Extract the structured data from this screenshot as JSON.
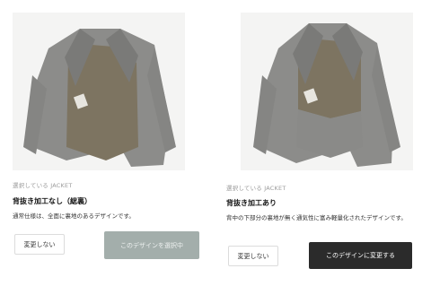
{
  "options": [
    {
      "image": {
        "alt_icon": "jacket-image-no-back-lining-cut"
      },
      "caption": "選択している JACKET",
      "title": "背抜き加工なし（総裏）",
      "description": "通常仕様は、全面に裏地のあるデザインです。",
      "keep_label": "変更しない",
      "action_label": "このデザインを選択中",
      "action_state": "selected"
    },
    {
      "image": {
        "alt_icon": "jacket-image-with-back-lining-cut"
      },
      "caption": "選択している JACKET",
      "title": "背抜き加工あり",
      "description": "背中の下部分の裏地が無く通気性に富み軽量化されたデザインです。",
      "keep_label": "変更しない",
      "action_label": "このデザインに変更する",
      "action_state": "available"
    }
  ],
  "colors": {
    "selected_button": "#a3aeab",
    "primary_button": "#2b2b2b",
    "jacket_grey": "#8a8a88",
    "lining": "#7d7461"
  }
}
